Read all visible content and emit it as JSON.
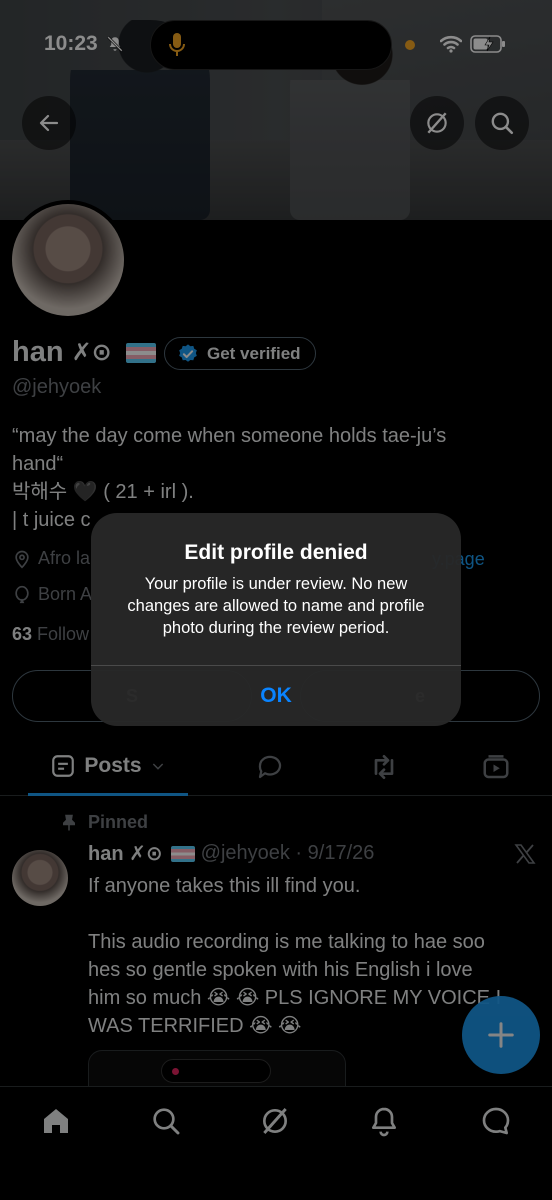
{
  "status_bar": {
    "time": "10:23"
  },
  "profile": {
    "display_name": "han",
    "name_symbols": "✗⊙",
    "verify_label": "Get verified",
    "handle": "@jehyoek",
    "bio_lines": [
      "“may the day come when someone holds tae-ju’s",
      "hand“",
      " 박해수 🖤 ( 21 + irl ).",
      "| t juice c"
    ],
    "location": "Afro la",
    "link": "y.page",
    "born": "Born A",
    "following_count": "63",
    "following_label": "Follow",
    "action_left": "S",
    "action_right": "e"
  },
  "tabs": {
    "posts": "Posts"
  },
  "post": {
    "pinned_label": "Pinned",
    "author_name": "han ✗⊙",
    "handle_date": "@jehyoek · 9/17/26",
    "text_lines": [
      "If anyone takes this ill find you.",
      "",
      "This audio recording is me talking to hae soo",
      "hes so gentle spoken with his English i love",
      "him so much 😭 😭 PLS IGNORE MY VOICE I",
      "WAS TERRIFIED 😭 😭"
    ]
  },
  "alert": {
    "title": "Edit profile denied",
    "message": "Your profile is under review. No new changes are allowed to name and profile photo during the review period.",
    "ok_label": "OK"
  },
  "colors": {
    "accent": "#1d9bf0",
    "ios_blue": "#0a84ff",
    "muted": "#71767b"
  },
  "icons": [
    "back-arrow-icon",
    "grok-icon",
    "search-icon",
    "verified-badge-icon",
    "location-icon",
    "balloon-icon",
    "pin-icon",
    "x-logo-icon",
    "compose-plus-icon",
    "home-icon",
    "bell-icon",
    "messages-icon"
  ]
}
